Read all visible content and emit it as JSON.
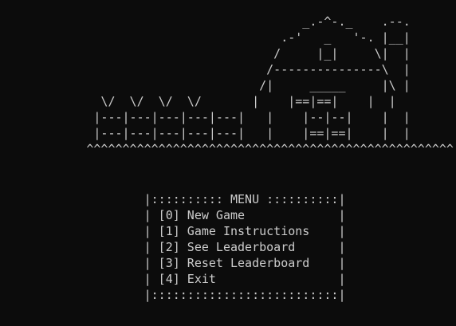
{
  "theme": {
    "background": "#0c0c0c",
    "foreground": "#cccccc"
  },
  "art": {
    "lines": [
      "                                          _.-^-._    .--.",
      "                                       .-'   _   '-. |__|",
      "                                      /     |_|     \\|  |",
      "                                     /---------------\\  |",
      "                                    /|     _____     |\\ |",
      "              \\/  \\/  \\/  \\/       |    |==|==|    |  |",
      "             |---|---|---|---|---|   |    |--|--|    |  |",
      "             |---|---|---|---|---|   |    |==|==|    |  |",
      "            ^^^^^^^^^^^^^^^^^^^^^^^^^^^^^^^^^^^^^^^^^^^^^^^^^^^"
    ]
  },
  "menu": {
    "top_border": "                    |:::::::::: MENU ::::::::::|",
    "items": [
      {
        "key": "[0]",
        "label": "New Game",
        "line": "                    | [0] New Game             |"
      },
      {
        "key": "[1]",
        "label": "Game Instructions",
        "line": "                    | [1] Game Instructions    |"
      },
      {
        "key": "[2]",
        "label": "See Leaderboard",
        "line": "                    | [2] See Leaderboard      |"
      },
      {
        "key": "[3]",
        "label": "Reset Leaderboard",
        "line": "                    | [3] Reset Leaderboard    |"
      },
      {
        "key": "[4]",
        "label": "Exit",
        "line": "                    | [4] Exit                 |"
      }
    ],
    "bottom_border": "                    |::::::::::::::::::::::::::|"
  }
}
